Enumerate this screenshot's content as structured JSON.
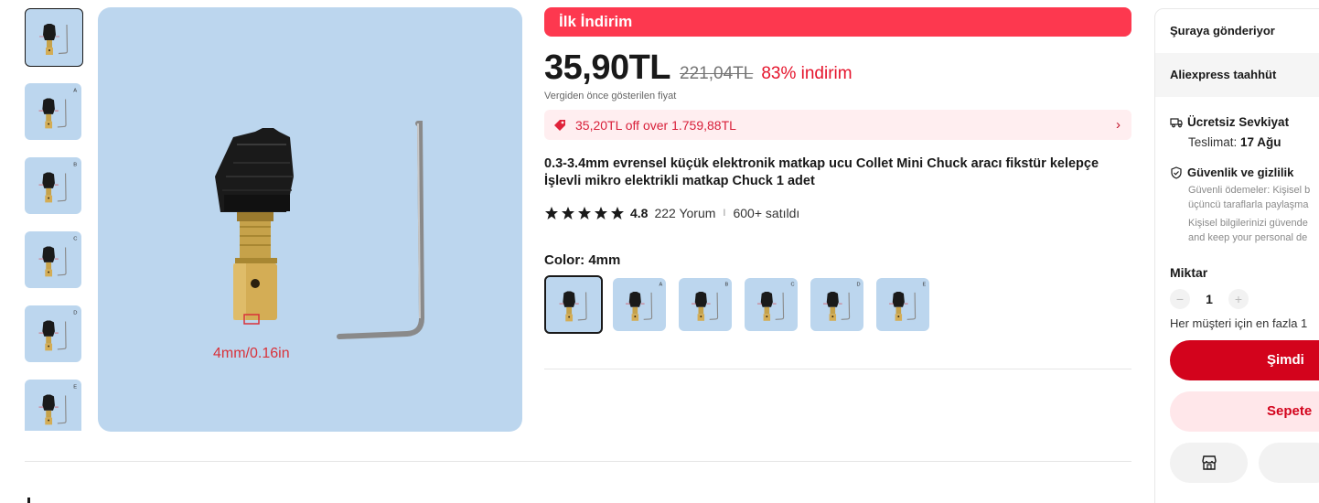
{
  "gallery": {
    "thumbnail_count": 6,
    "thumb_letters": [
      "",
      "A",
      "B",
      "C",
      "D",
      "E"
    ],
    "main_caption": "4mm/0.16in"
  },
  "promo": {
    "label": "İlk İndirim"
  },
  "price": {
    "current": "35,90TL",
    "original": "221,04TL",
    "discount": "83% indirim",
    "note": "Vergiden önce gösterilen fiyat"
  },
  "coupon": {
    "text": "35,20TL off over 1.759,88TL"
  },
  "product": {
    "title": "0.3-3.4mm evrensel küçük elektronik matkap ucu Collet Mini Chuck aracı fikstür kelepçe İşlevli mikro elektrikli matkap Chuck 1 adet",
    "rating": "4.8",
    "reviews": "222 Yorum",
    "separator": "I",
    "sold": "600+ satıldı"
  },
  "variant": {
    "label": "Color: 4mm",
    "options": [
      "4mm",
      "A",
      "B",
      "C",
      "D",
      "E"
    ],
    "selected_index": 0
  },
  "side": {
    "ship_to": "Şuraya gönderiyor",
    "commitment": "Aliexpress taahhüt",
    "free_shipping": "Ücretsiz Sevkiyat",
    "delivery_prefix": "Teslimat:",
    "delivery_date": "17 Ağu",
    "security_title": "Güvenlik ve gizlilik",
    "security_line1": "Güvenli ödemeler: Kişisel b",
    "security_line2": "üçüncü taraflarla paylaşma",
    "security_line3": "Kişisel bilgilerinizi güvende",
    "security_line4": "and keep your personal de",
    "qty_label": "Miktar",
    "qty_value": "1",
    "qty_minus": "−",
    "qty_plus": "+",
    "qty_limit": "Her müşteri için en fazla 1",
    "buy_now": "Şimdi",
    "add_to_cart": "Sepete"
  },
  "colors": {
    "brand_red": "#fd384f",
    "buy_red": "#d3031c",
    "image_bg": "#bcd6ee"
  }
}
